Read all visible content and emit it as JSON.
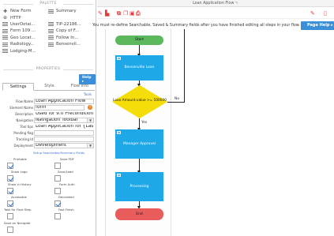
{
  "app": {
    "window_title": "Loan Application Flow",
    "notice": "You must re-define Searchable, Saved & Summary fields after you have finished editing all steps in your flow.",
    "page_help_label": "Page Help",
    "page_help_arrow": "▸"
  },
  "palette": {
    "title": "PALETTE",
    "items": [
      {
        "label": "New Form",
        "icon": "plus-icon",
        "glyph": "✚"
      },
      {
        "label": "Summary",
        "icon": "list-icon",
        "glyph": ""
      },
      {
        "label": "HTTP",
        "icon": "globe-icon",
        "glyph": "⊕"
      },
      {
        "label": "",
        "icon": "",
        "glyph": ""
      },
      {
        "label": "UserDetai...",
        "icon": "list-icon",
        "glyph": ""
      },
      {
        "label": "TIP-22186...",
        "icon": "list-icon",
        "glyph": ""
      },
      {
        "label": "Form 109 ...",
        "icon": "list-icon",
        "glyph": ""
      },
      {
        "label": "Copy of F...",
        "icon": "list-icon",
        "glyph": ""
      },
      {
        "label": "Geo Locat...",
        "icon": "list-icon",
        "glyph": ""
      },
      {
        "label": "Follow In...",
        "icon": "list-icon",
        "glyph": ""
      },
      {
        "label": "Radiology...",
        "icon": "list-icon",
        "glyph": ""
      },
      {
        "label": "Bensenvil...",
        "icon": "list-icon",
        "glyph": ""
      },
      {
        "label": "Lodging-M...",
        "icon": "list-icon",
        "glyph": ""
      }
    ]
  },
  "properties": {
    "title": "PROPERTIES",
    "help_label": "Help",
    "help_arrow": "▸",
    "tabs": [
      "Settings",
      "Style",
      "Flow Info"
    ],
    "tools_label": "Tools",
    "fields": [
      {
        "label": "Flow Name",
        "value": "Loan Application Flow",
        "type": "input"
      },
      {
        "label": "Element Name",
        "value": "form",
        "type": "input"
      },
      {
        "label": "Description",
        "value": "Used for 9.0 Precondition",
        "type": "text"
      },
      {
        "label": "Navigation",
        "value": "Navigation Toolbar",
        "type": "select"
      },
      {
        "label": "Tool tips",
        "value": "Loan Application for {LastName}",
        "type": "text"
      },
      {
        "label": "Pending flag",
        "value": "",
        "type": "input"
      },
      {
        "label": "Tracking Id",
        "value": "",
        "type": "input"
      },
      {
        "label": "Deployment",
        "value": "Development",
        "type": "select"
      }
    ],
    "setup_link": "Setup Searchable/Summary Fields",
    "checkboxes": [
      {
        "label": "Printable",
        "checked": true
      },
      {
        "label": "Save PDF",
        "checked": false
      },
      {
        "label": "Show Logo",
        "checked": true
      },
      {
        "label": "Save/Load",
        "checked": false
      },
      {
        "label": "Show in History",
        "checked": true
      },
      {
        "label": "Form Auth",
        "checked": false
      },
      {
        "label": "Accessible",
        "checked": true
      },
      {
        "label": "Decorated",
        "checked": true
      },
      {
        "label": "Task for Final Step",
        "checked": false
      },
      {
        "label": "Fast Finish",
        "checked": false
      },
      {
        "label": "Save on Navigate",
        "checked": false
      }
    ]
  },
  "flow": {
    "start": "Start",
    "step1": "Bensenville Loan Applicati...",
    "decision": "Loan Amount.value >= 500000",
    "no_label": "No",
    "yes_label": "Yes",
    "step2": "Manager Approval",
    "step3": "Processing",
    "end": "End"
  },
  "colors": {
    "start": "#5cb85c",
    "step": "#1fa8e8",
    "decision": "#f5dd0a",
    "end": "#e95c5c",
    "accent": "#3b8fd8"
  }
}
